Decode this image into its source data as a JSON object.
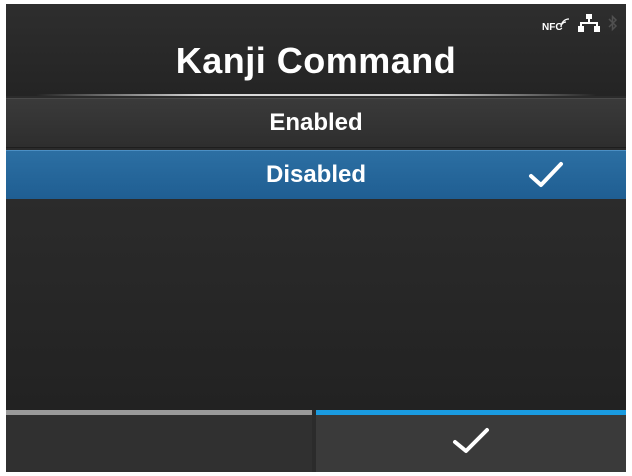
{
  "header": {
    "title": "Kanji Command",
    "status": {
      "nfc_label": "NFC",
      "icons": [
        "nfc-icon",
        "network-icon",
        "bluetooth-icon"
      ]
    }
  },
  "options": [
    {
      "label": "Enabled",
      "selected": false
    },
    {
      "label": "Disabled",
      "selected": true
    }
  ],
  "footer": {
    "left_button": "",
    "right_button_icon": "check-icon"
  },
  "colors": {
    "background": "#2b2b2b",
    "selection": "#2369a0",
    "accent": "#1a9be0",
    "text": "#ffffff"
  }
}
